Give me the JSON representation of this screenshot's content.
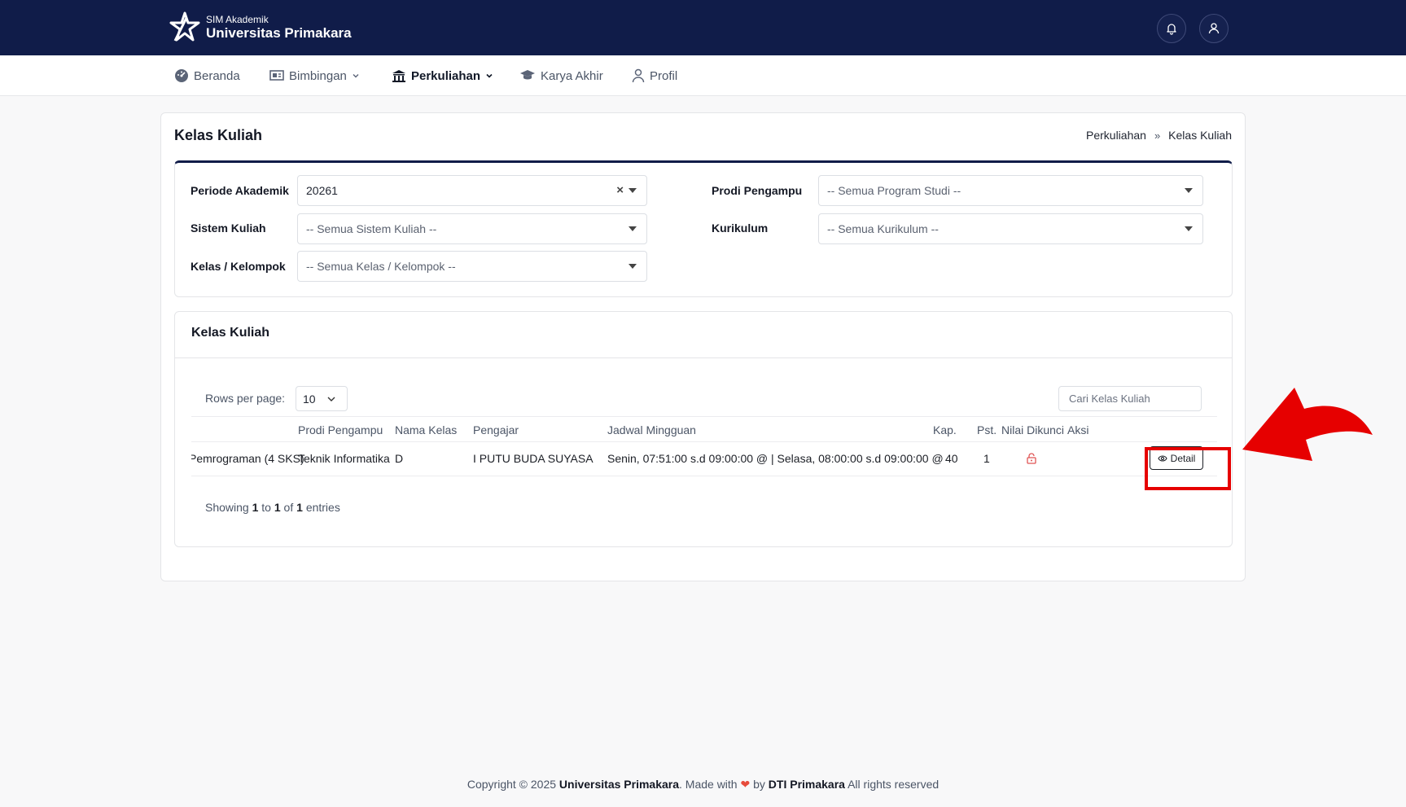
{
  "header": {
    "brand_sub": "SIM Akademik",
    "brand_name": "Universitas Primakara",
    "icons": [
      "bell-icon",
      "user-icon"
    ]
  },
  "nav": {
    "items": [
      {
        "label": "Beranda",
        "icon": "gauge-icon"
      },
      {
        "label": "Bimbingan",
        "icon": "board-icon",
        "dropdown": true
      },
      {
        "label": "Perkuliahan",
        "icon": "university-icon",
        "dropdown": true,
        "active": true
      },
      {
        "label": "Karya Akhir",
        "icon": "graduation-cap-icon"
      },
      {
        "label": "Profil",
        "icon": "user-icon"
      }
    ]
  },
  "page": {
    "title": "Kelas Kuliah",
    "breadcrumb": [
      "Perkuliahan",
      "Kelas Kuliah"
    ],
    "breadcrumb_sep": "»"
  },
  "filters": {
    "periode_label": "Periode Akademik",
    "periode_value": "20261",
    "sistem_label": "Sistem Kuliah",
    "sistem_value": "-- Semua Sistem Kuliah --",
    "kelas_label": "Kelas / Kelompok",
    "kelas_value": "-- Semua Kelas / Kelompok --",
    "prodi_label": "Prodi Pengampu",
    "prodi_value": "-- Semua Program Studi --",
    "kurikulum_label": "Kurikulum",
    "kurikulum_value": "-- Semua Kurikulum --"
  },
  "table": {
    "title": "Kelas Kuliah",
    "rows_per_page_label": "Rows per page:",
    "rows_per_page_value": "10",
    "search_placeholder": "Cari Kelas Kuliah",
    "columns": [
      "Prodi Pengampu",
      "Nama Kelas",
      "Pengajar",
      "Jadwal Mingguan",
      "Kap.",
      "Pst.",
      "Nilai Dikunci",
      "Aksi"
    ],
    "rows": [
      {
        "mata_kuliah": "Pemrograman (4 SKS)",
        "prodi": "Teknik Informatika",
        "nama_kelas": "D",
        "pengajar": "I PUTU BUDA SUYASA",
        "jadwal": "Senin, 07:51:00 s.d 09:00:00 @ | Selasa, 08:00:00 s.d 09:00:00 @",
        "kap": "40",
        "pst": "1",
        "nilai_dikunci_icon": "unlock-icon",
        "aksi_label": "Detail"
      }
    ],
    "showing": {
      "prefix": "Showing",
      "from": "1",
      "to_word": "to",
      "to": "1",
      "of_word": "of",
      "total": "1",
      "suffix": "entries"
    }
  },
  "footer": {
    "copyright": "Copyright © 2025",
    "org": "Universitas Primakara",
    "made_with": ". Made with",
    "by": "by",
    "team": "DTI Primakara",
    "rights": "All rights reserved"
  },
  "colors": {
    "header_bg": "#101c49",
    "highlight": "#e60000",
    "lock_icon": "#e05555"
  }
}
